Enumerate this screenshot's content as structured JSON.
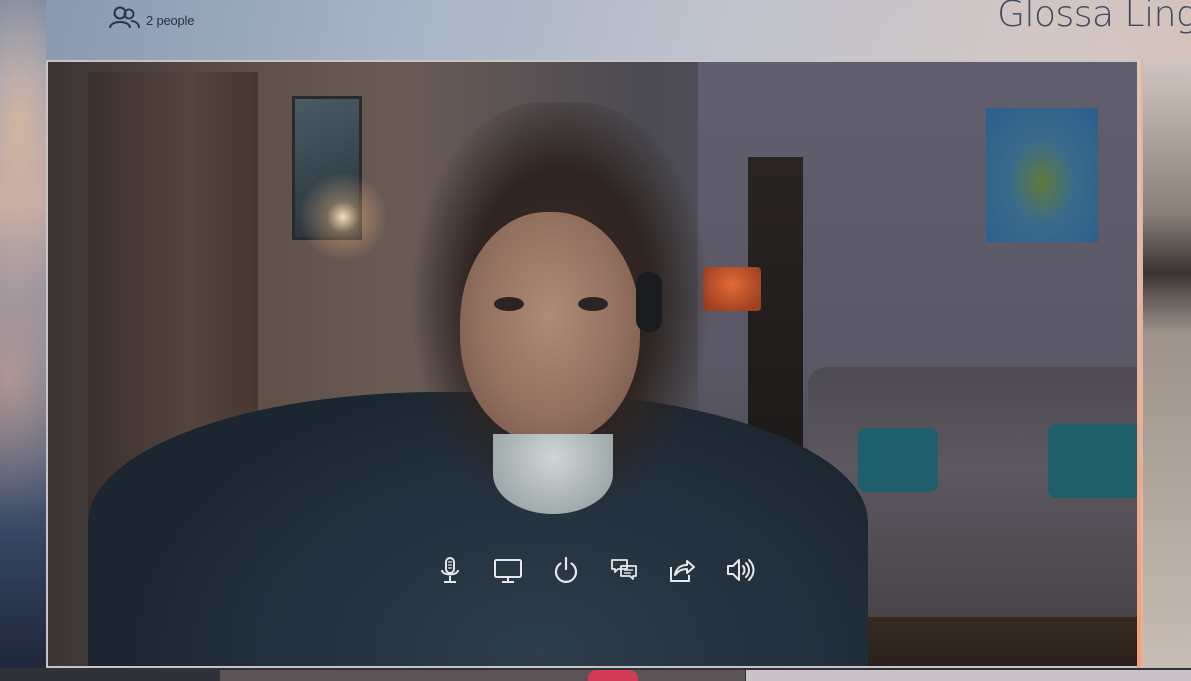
{
  "header": {
    "participants_label": "2 people",
    "brand_text": "Glossa Ling"
  },
  "icons": {
    "participants": "people-icon",
    "microphone": "microphone-icon",
    "screen_share": "monitor-icon",
    "end_call": "power-icon",
    "chat": "chat-icon",
    "share": "share-icon",
    "volume": "volume-icon"
  },
  "colors": {
    "icon_color": "#e8e8ea",
    "header_text": "#2a3148",
    "brand_text": "#3f4a60",
    "accent_badge": "#d23b55"
  }
}
